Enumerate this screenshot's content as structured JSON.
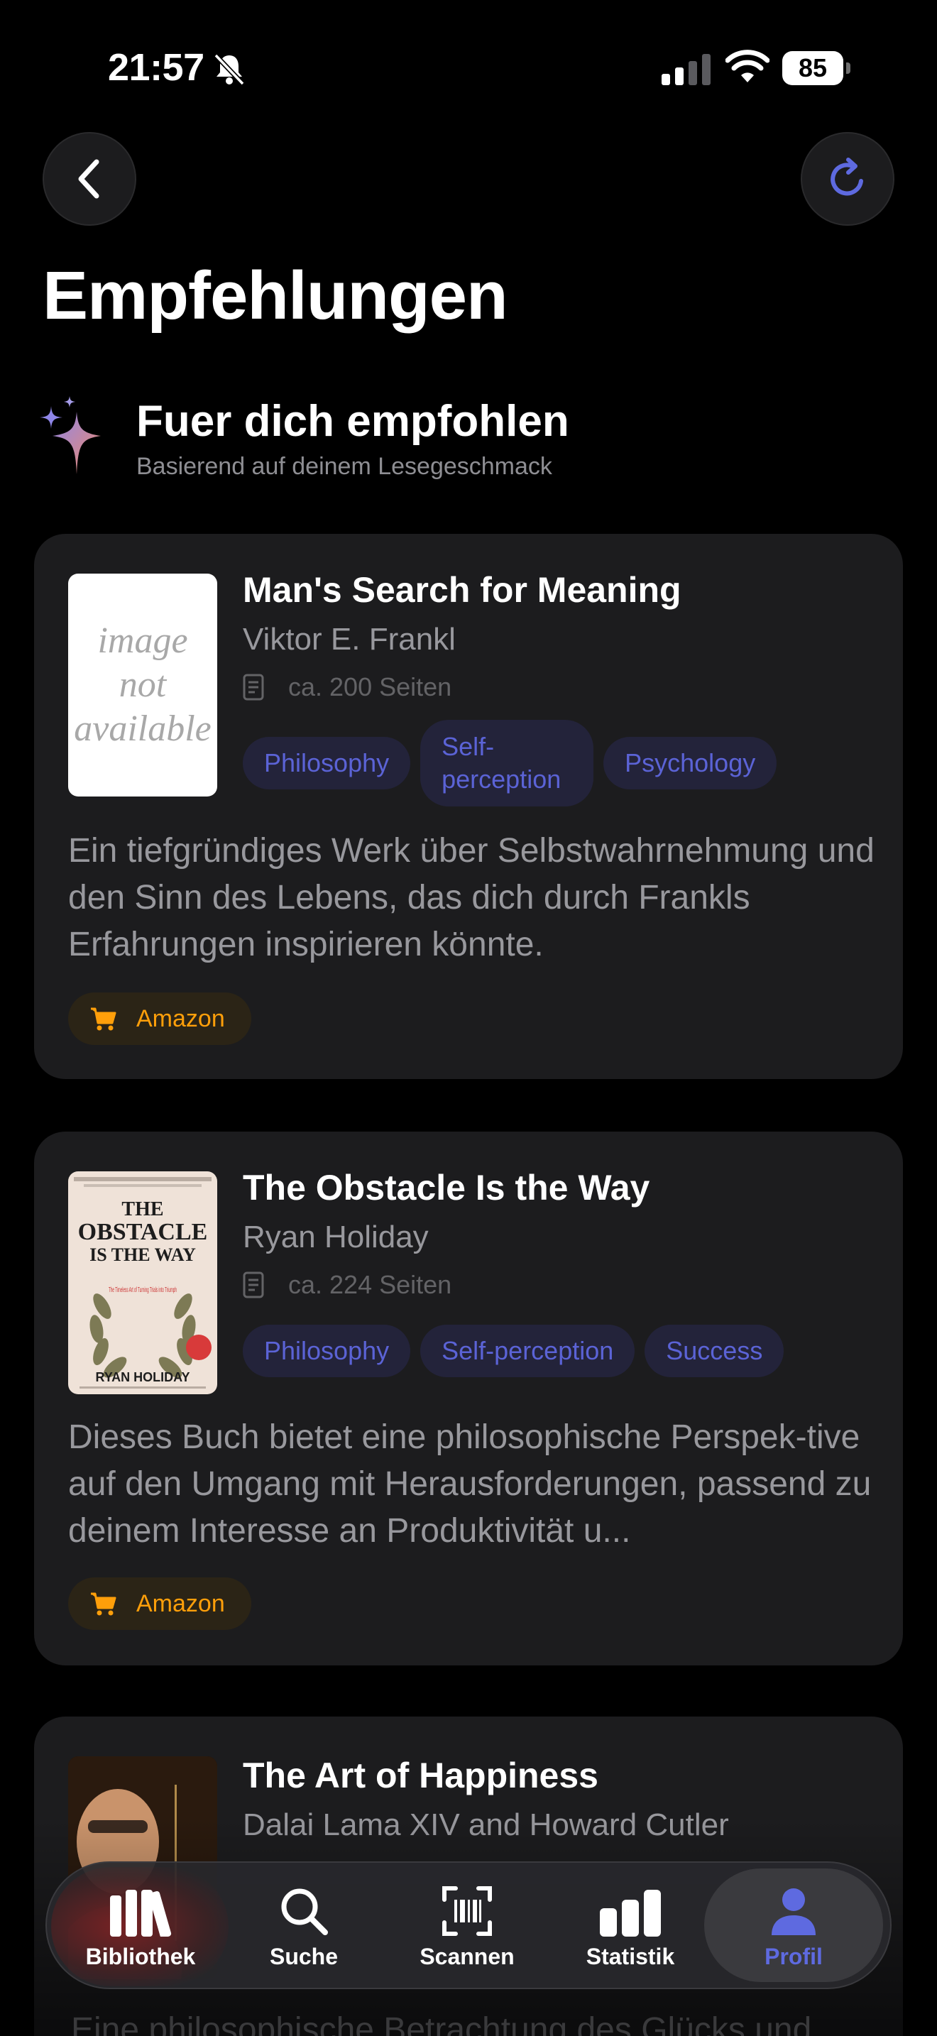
{
  "status_bar": {
    "time": "21:57",
    "battery": "85"
  },
  "header": {
    "title": "Empfehlungen"
  },
  "section": {
    "title": "Fuer dich empfohlen",
    "subtitle": "Basierend auf deinem Lesegeschmack"
  },
  "books": [
    {
      "title": "Man's Search for Meaning",
      "author": "Viktor E. Frankl",
      "pages": "ca. 200 Seiten",
      "cover_placeholder": [
        "image",
        "not",
        "available"
      ],
      "tags": [
        "Philosophy",
        "Self-perception",
        "Psychology"
      ],
      "description": "Ein tiefgründiges Werk über Selbstwahrnehmung und den Sinn des Lebens, das dich durch Frankls Erfahrungen inspirieren könnte.",
      "shop_label": "Amazon"
    },
    {
      "title": "The Obstacle Is the Way",
      "author": "Ryan Holiday",
      "pages": "ca. 224 Seiten",
      "tags": [
        "Philosophy",
        "Self-perception",
        "Success"
      ],
      "description": "Dieses Buch bietet eine philosophische Perspek-tive auf den Umgang mit Herausforderungen, passend zu deinem Interesse an Produktivität u...",
      "shop_label": "Amazon",
      "cover_text": {
        "line1": "THE",
        "line2": "OBSTACLE",
        "line3": "IS THE WAY",
        "sub": "The Timeless Art of Turning Trials into Triumph",
        "author": "RYAN HOLIDAY"
      }
    },
    {
      "title": "The Art of Happiness",
      "author": "Dalai Lama XIV and Howard Cutler",
      "description_peek": "Eine philosophische Betrachtung des Glücks und"
    }
  ],
  "tabbar": {
    "items": [
      {
        "label": "Bibliothek",
        "icon": "books-icon"
      },
      {
        "label": "Suche",
        "icon": "search-icon"
      },
      {
        "label": "Scannen",
        "icon": "barcode-scan-icon"
      },
      {
        "label": "Statistik",
        "icon": "bar-chart-icon"
      },
      {
        "label": "Profil",
        "icon": "person-icon",
        "active": true
      }
    ]
  },
  "colors": {
    "accent": "#5e6ae0",
    "tag_text": "#5b63d6",
    "amazon": "#ff9f0a",
    "card": "#1c1c1e"
  }
}
